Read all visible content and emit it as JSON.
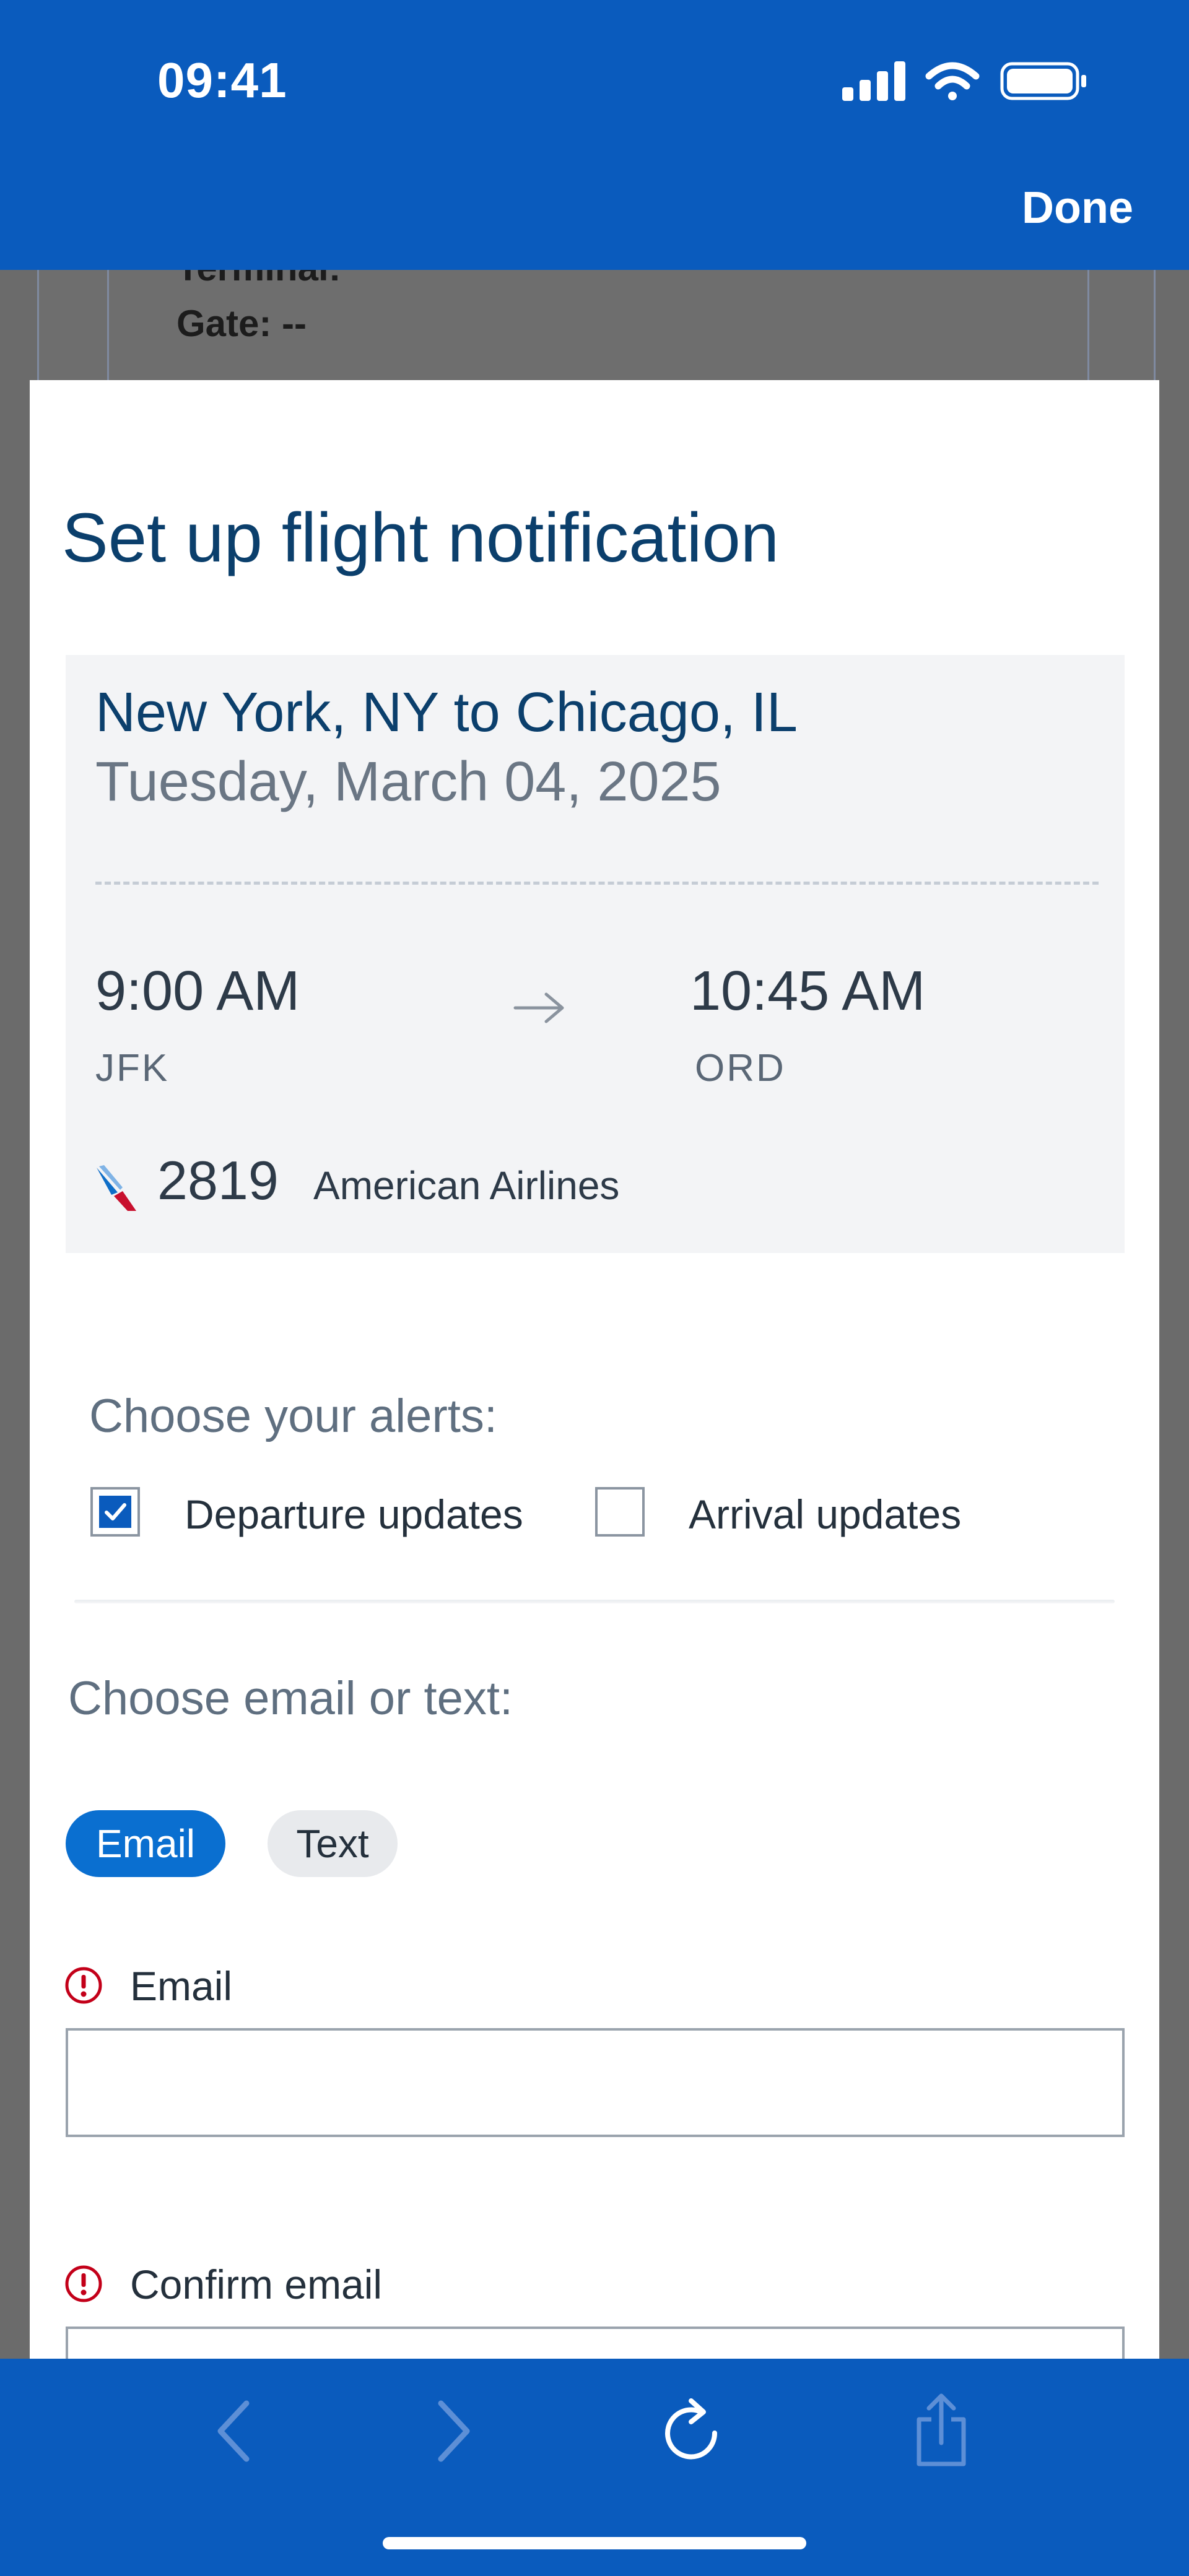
{
  "status_bar": {
    "time": "09:41"
  },
  "header": {
    "done_label": "Done"
  },
  "background_page": {
    "terminal_text": "Terminal:",
    "gate_text": "Gate: --"
  },
  "modal": {
    "title": "Set up flight notification",
    "flight": {
      "route": "New York, NY to Chicago, IL",
      "date": "Tuesday, March 04, 2025",
      "departure_time": "9:00 AM",
      "departure_code": "JFK",
      "arrival_time": "10:45 AM",
      "arrival_code": "ORD",
      "flight_number": "2819",
      "airline": "American Airlines"
    },
    "alerts": {
      "label": "Choose your alerts:",
      "departure": {
        "label": "Departure updates",
        "checked": true
      },
      "arrival": {
        "label": "Arrival updates",
        "checked": false
      }
    },
    "contact": {
      "label": "Choose email or text:",
      "email_option": "Email",
      "text_option": "Text",
      "selected": "Email"
    },
    "fields": {
      "email": {
        "label": "Email",
        "value": "",
        "placeholder": ""
      },
      "confirm_email": {
        "label": "Confirm email",
        "value": "",
        "placeholder": ""
      }
    }
  },
  "colors": {
    "brand_blue": "#0a5bbd",
    "title_navy": "#0b3f6c",
    "error_red": "#c30019",
    "pill_active": "#0a6fd0"
  },
  "icons": {
    "signal": "cellular-signal-icon",
    "wifi": "wifi-icon",
    "battery": "battery-icon",
    "arrow": "arrow-right-icon",
    "airline_logo": "american-airlines-logo",
    "checkmark": "checkmark-icon",
    "error": "error-alert-icon",
    "back": "chevron-left-icon",
    "forward": "chevron-right-icon",
    "reload": "reload-icon",
    "share": "share-icon"
  }
}
